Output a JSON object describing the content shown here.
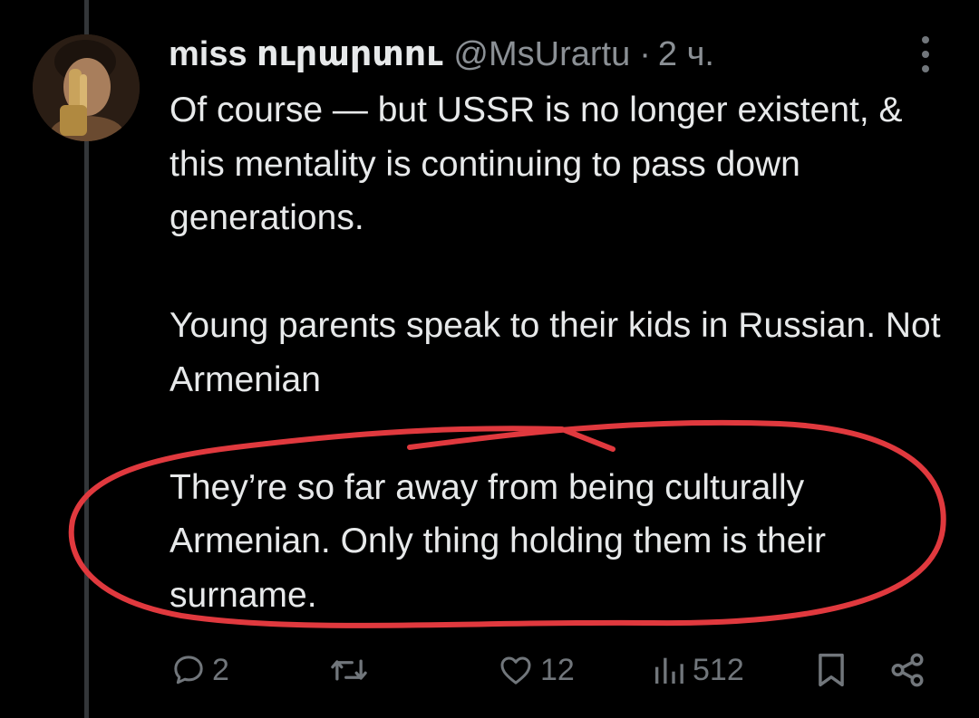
{
  "tweet": {
    "display_name": "miss ուրարտու",
    "handle": "@MsUrartu",
    "separator": "·",
    "time": "2 ч.",
    "paragraphs": [
      "Of course — but USSR is no longer existent, & this mentality is continuing to pass down generations.",
      "Young parents speak to their kids in Russian. Not Armenian",
      "They’re so far away from being culturally Armenian. Only thing holding them is their surname."
    ]
  },
  "actions": {
    "reply_count": "2",
    "like_count": "12",
    "views_count": "512"
  },
  "icons": {
    "avatar": "avatar-photo",
    "more": "more-vertical-icon",
    "reply": "reply-icon",
    "retweet": "retweet-icon",
    "like": "heart-icon",
    "views": "views-chart-icon",
    "bookmark": "bookmark-icon",
    "share": "share-icon"
  },
  "colors": {
    "background": "#000000",
    "text": "#e7e9ea",
    "muted": "#71767b",
    "annotation": "#e0393e"
  }
}
